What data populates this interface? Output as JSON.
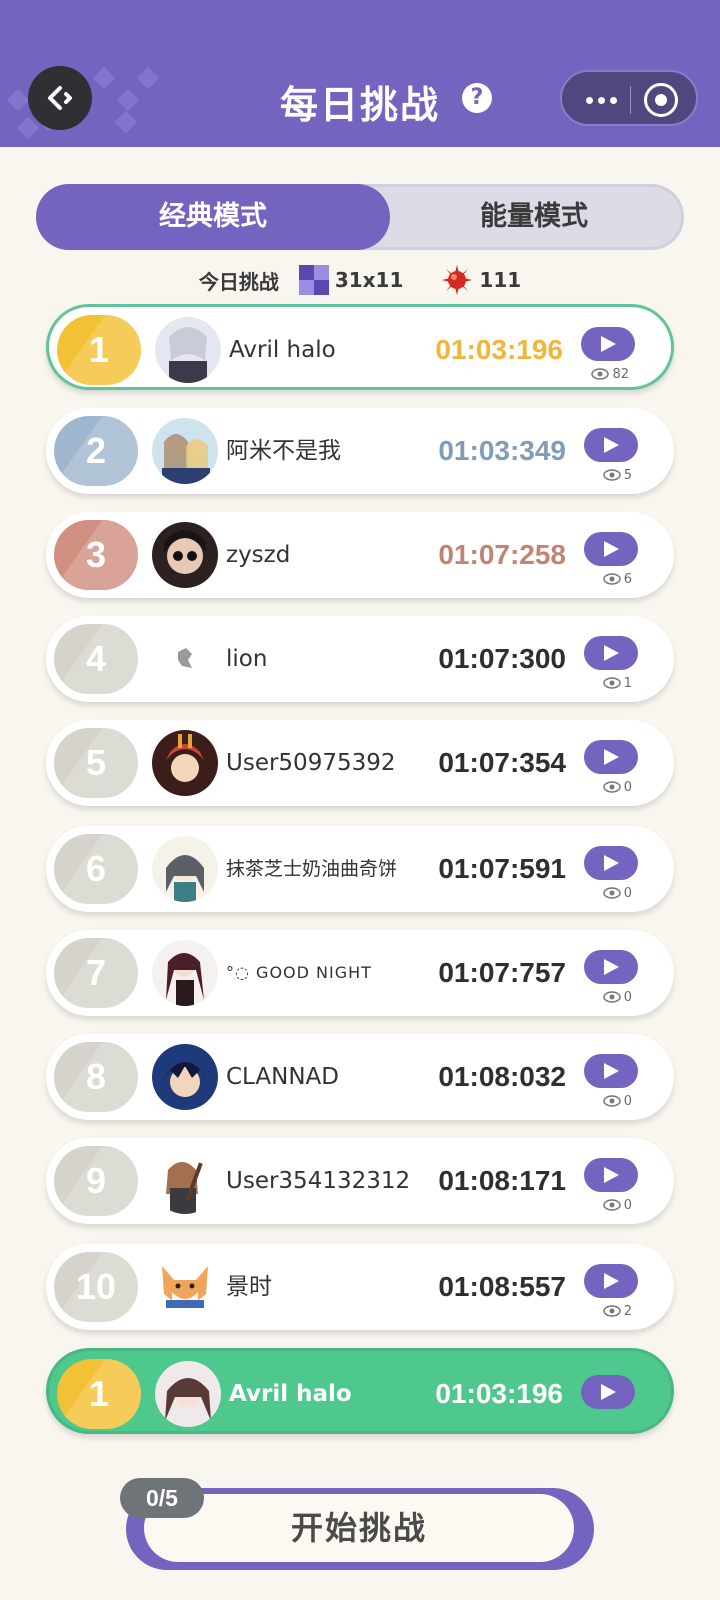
{
  "header": {
    "title": "每日挑战",
    "help_icon": "question-icon",
    "back_icon": "back-arrow-icon",
    "more_icon": "more-dots-icon",
    "close_icon": "target-circle-icon",
    "bg_color": "#7463bf"
  },
  "tabs": [
    {
      "label": "经典模式",
      "active": true
    },
    {
      "label": "能量模式",
      "active": false
    }
  ],
  "today": {
    "label": "今日挑战",
    "board_size": "31x11",
    "mine_count": "111"
  },
  "leaderboard": [
    {
      "rank": "1",
      "name": "Avril halo",
      "time": "01:03:196",
      "views": "82",
      "medal": "gold"
    },
    {
      "rank": "2",
      "name": "阿米不是我",
      "time": "01:03:349",
      "views": "5",
      "medal": "silver"
    },
    {
      "rank": "3",
      "name": "zyszd",
      "time": "01:07:258",
      "views": "6",
      "medal": "bronze"
    },
    {
      "rank": "4",
      "name": "lion",
      "time": "01:07:300",
      "views": "1",
      "medal": "plain"
    },
    {
      "rank": "5",
      "name": "User50975392",
      "time": "01:07:354",
      "views": "0",
      "medal": "plain"
    },
    {
      "rank": "6",
      "name": "抹茶芝士奶油曲奇饼",
      "time": "01:07:591",
      "views": "0",
      "medal": "plain"
    },
    {
      "rank": "7",
      "name": "°◌ GOOD NIGHT",
      "time": "01:07:757",
      "views": "0",
      "medal": "plain"
    },
    {
      "rank": "8",
      "name": "CLANNAD",
      "time": "01:08:032",
      "views": "0",
      "medal": "plain"
    },
    {
      "rank": "9",
      "name": "User354132312",
      "time": "01:08:171",
      "views": "0",
      "medal": "plain"
    },
    {
      "rank": "10",
      "name": "景时",
      "time": "01:08:557",
      "views": "2",
      "medal": "plain"
    }
  ],
  "self": {
    "rank": "1",
    "name": "Avril halo",
    "time": "01:03:196"
  },
  "start": {
    "label": "开始挑战",
    "attempts": "0/5"
  },
  "colors": {
    "accent": "#7463bf",
    "self_row": "#4fc88e",
    "gold": "#f3c136",
    "silver": "#9fb6cf",
    "bronze": "#d18f82"
  }
}
